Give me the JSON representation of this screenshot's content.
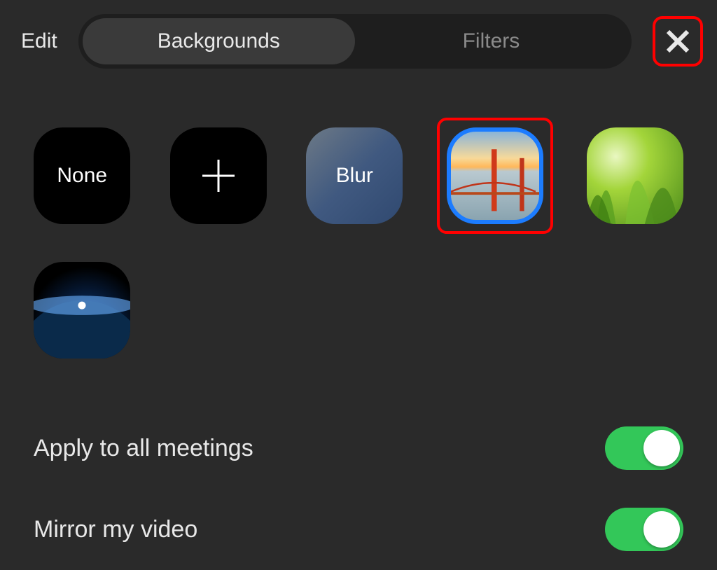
{
  "header": {
    "edit_label": "Edit",
    "tab_backgrounds": "Backgrounds",
    "tab_filters": "Filters",
    "active_tab": "Backgrounds"
  },
  "tiles": {
    "none_label": "None",
    "add_icon": "plus-icon",
    "blur_label": "Blur",
    "image1_name": "golden-gate-bridge",
    "image2_name": "green-grass",
    "image3_name": "earth-from-space",
    "selected": "golden-gate-bridge"
  },
  "settings": {
    "apply_all_label": "Apply to all meetings",
    "apply_all_on": true,
    "mirror_label": "Mirror my video",
    "mirror_on": true
  },
  "highlights": {
    "close_button": true,
    "selected_tile": true
  },
  "colors": {
    "accent_blue": "#1c7cff",
    "toggle_green": "#33c759",
    "highlight_red": "#ff0000"
  }
}
